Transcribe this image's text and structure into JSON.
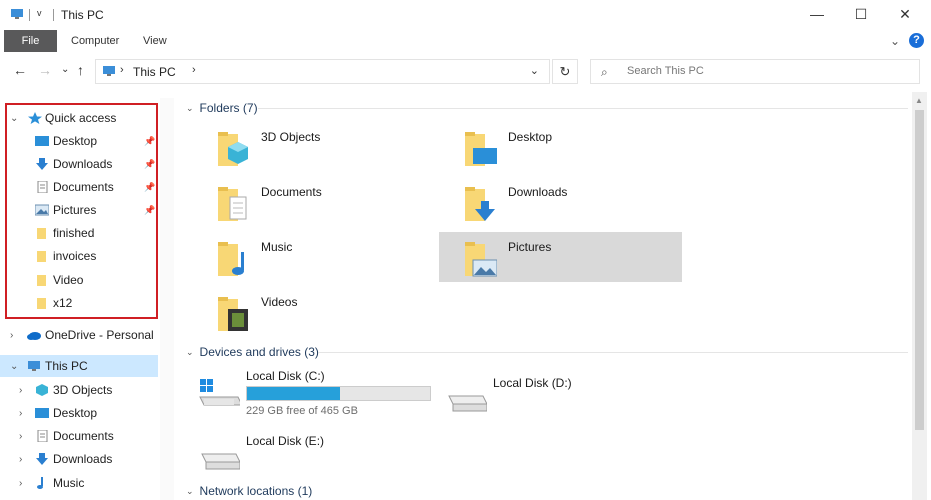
{
  "window": {
    "title": "This PC",
    "qat_dropdown": "v",
    "minimize": "—",
    "maximize": "☐",
    "close": "✕"
  },
  "ribbon": {
    "tabs": [
      "File",
      "Computer",
      "View"
    ],
    "collapse": "⌄",
    "help": "?"
  },
  "address": {
    "back": "←",
    "forward": "→",
    "recent": "⌄",
    "up": "↑",
    "path": "This PC",
    "refresh": "↻",
    "search_placeholder": "Search This PC"
  },
  "nav": {
    "quick_access": "Quick access",
    "qa_items": [
      {
        "label": "Desktop",
        "icon": "desktop-icon",
        "pinned": true
      },
      {
        "label": "Downloads",
        "icon": "downloads-icon",
        "pinned": true
      },
      {
        "label": "Documents",
        "icon": "documents-icon",
        "pinned": true
      },
      {
        "label": "Pictures",
        "icon": "pictures-icon",
        "pinned": true
      },
      {
        "label": "finished",
        "icon": "folder-icon",
        "pinned": false
      },
      {
        "label": "invoices",
        "icon": "folder-icon",
        "pinned": false
      },
      {
        "label": "Video",
        "icon": "folder-icon",
        "pinned": false
      },
      {
        "label": "x12",
        "icon": "folder-icon",
        "pinned": false
      }
    ],
    "onedrive": "OneDrive - Personal",
    "this_pc": "This PC",
    "pc_items": [
      "3D Objects",
      "Desktop",
      "Documents",
      "Downloads",
      "Music"
    ]
  },
  "content": {
    "folders_header": "Folders (7)",
    "folders": [
      "3D Objects",
      "Desktop",
      "Documents",
      "Downloads",
      "Music",
      "Pictures",
      "Videos"
    ],
    "devices_header": "Devices and drives (3)",
    "drives": [
      {
        "label": "Local Disk (C:)",
        "free": "229 GB free of 465 GB",
        "used_fraction": 0.51
      },
      {
        "label": "Local Disk (D:)"
      },
      {
        "label": "Local Disk (E:)"
      }
    ],
    "network_header": "Network locations (1)"
  },
  "colors": {
    "accent": "#26a0da",
    "selection": "#cce8ff",
    "highlight_box": "#d01f24",
    "folder_yellow": "#f8d775"
  }
}
